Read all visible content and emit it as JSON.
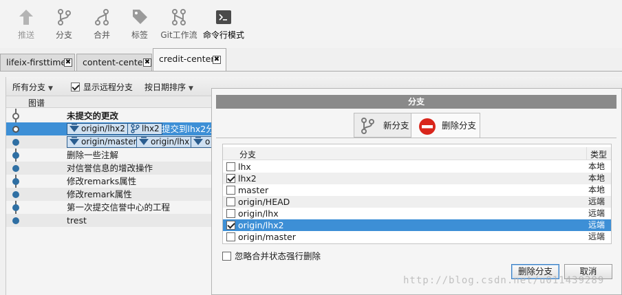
{
  "toolbar": {
    "push": "推送",
    "branch": "分支",
    "merge": "合并",
    "tag": "标签",
    "gitflow": "Git工作流",
    "terminal": "命令行模式"
  },
  "tabs": [
    {
      "label": "lifeix-firsttime"
    },
    {
      "label": "content-center"
    },
    {
      "label": "credit-center"
    }
  ],
  "close_glyph": "✖",
  "filters": {
    "all_branches": "所有分支",
    "show_remote": "显示远程分支",
    "sort_by_date": "按日期排序"
  },
  "graph_header": "图谱",
  "commits": [
    {
      "text": "未提交的更改"
    },
    {
      "refs": [
        "origin/lhx2",
        "lhx2"
      ],
      "text": "提交到lhx2分"
    },
    {
      "refs": [
        "origin/master",
        "origin/lhx",
        "o"
      ]
    },
    {
      "text": "删除一些注解"
    },
    {
      "text": "对信誉信息的增改操作"
    },
    {
      "text": "修改remarks属性"
    },
    {
      "text": "修改remark属性"
    },
    {
      "text": "第一次提交信誉中心的工程"
    },
    {
      "text": "trest"
    }
  ],
  "dialog": {
    "title": "分支",
    "tab_new": "新分支",
    "tab_delete": "删除分支",
    "col_branch": "分支",
    "col_type": "类型",
    "branches": [
      {
        "name": "lhx",
        "type": "本地",
        "checked": false
      },
      {
        "name": "lhx2",
        "type": "本地",
        "checked": true
      },
      {
        "name": "master",
        "type": "本地",
        "checked": false
      },
      {
        "name": "origin/HEAD",
        "type": "远端",
        "checked": false
      },
      {
        "name": "origin/lhx",
        "type": "远端",
        "checked": false
      },
      {
        "name": "origin/lhx2",
        "type": "远端",
        "checked": true
      },
      {
        "name": "origin/master",
        "type": "远端",
        "checked": false
      }
    ],
    "force_delete": "忽略合并状态强行删除",
    "force_checked": false,
    "delete_btn": "删除分支",
    "cancel_btn": "取消"
  },
  "watermark": "http://blog.csdn.net/u011439289",
  "colors": {
    "selection": "#3d8fd6",
    "node": "#2f6fa3",
    "ref_bg": "#cfe0f1"
  },
  "icons": [
    "push-icon",
    "branch-icon",
    "merge-icon",
    "tag-icon",
    "gitflow-icon",
    "terminal-icon",
    "no-entry-icon"
  ]
}
